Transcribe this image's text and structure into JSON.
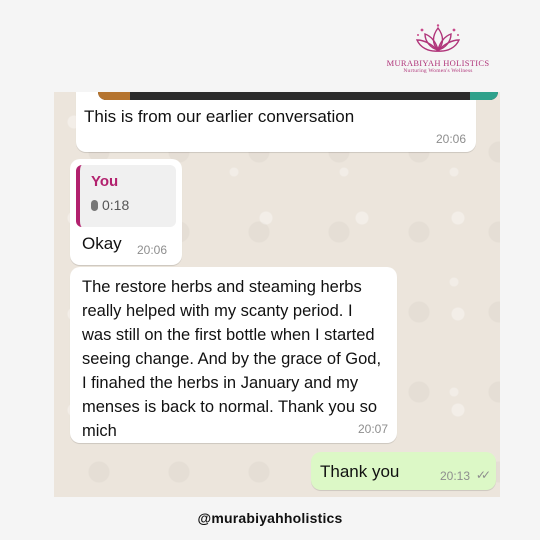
{
  "brand": {
    "name": "MURABIYAH HOLISTICS",
    "tagline": "Nurturing Women's Wellness",
    "accent_color": "#b0357a",
    "icon": "lotus-icon"
  },
  "chat": {
    "messages": [
      {
        "type": "received",
        "text": "This is from our earlier conversation",
        "time": "20:06"
      },
      {
        "type": "received",
        "quote_author": "You",
        "quote_voice_duration": "0:18",
        "quote_icon": "mic-icon",
        "text": "Okay",
        "time": "20:06"
      },
      {
        "type": "received",
        "text": "The restore herbs and steaming herbs really helped with my scanty period. I was still on the first bottle when I started seeing change. And by the grace of God,  I finahed the herbs in January and my menses is back to normal. Thank you so mich",
        "time": "20:07"
      },
      {
        "type": "sent",
        "text": "Thank you",
        "time": "20:13",
        "status_icon": "double-check-icon"
      }
    ],
    "sent_bubble_color": "#dcf8c6",
    "received_bubble_color": "#ffffff",
    "quote_accent_color": "#b2216e"
  },
  "footer": {
    "handle": "@murabiyahholistics"
  }
}
